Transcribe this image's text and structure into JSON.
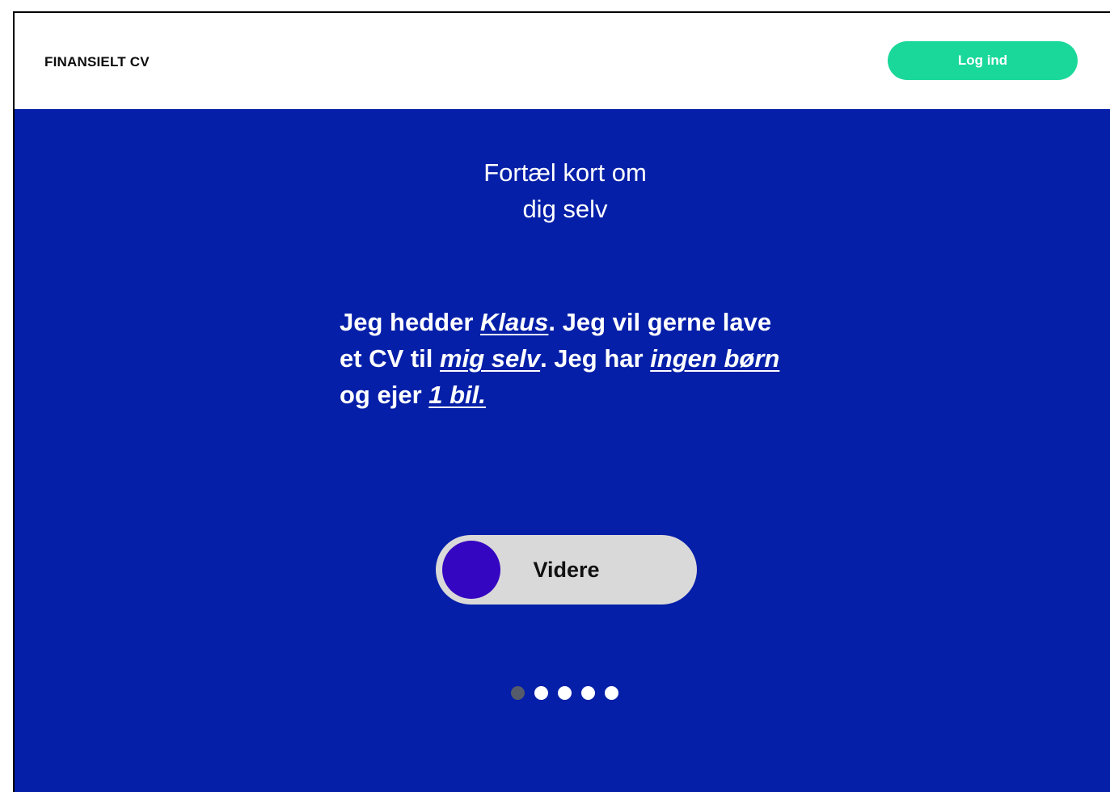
{
  "header": {
    "brand": "FINANSIELT CV",
    "login_label": "Log ind"
  },
  "main": {
    "heading_line1": "Fortæl kort om",
    "heading_line2": "dig selv",
    "statement": {
      "t1": "Jeg hedder ",
      "name": "Klaus",
      "t2": ". Jeg vil gerne lave et CV til ",
      "for_whom": "mig selv",
      "t3": ".  Jeg har ",
      "children": "ingen børn",
      "t4": " og ejer ",
      "cars": "1 bil."
    },
    "continue_label": "Videre",
    "pagination": {
      "total": 5,
      "current": 1
    }
  },
  "colors": {
    "background_blue": "#051fa8",
    "login_green": "#1ad89a",
    "slider_track": "#d9d9d9",
    "slider_knob": "#3406c1",
    "dot_active": "#555b6a",
    "dot_inactive": "#ffffff"
  }
}
